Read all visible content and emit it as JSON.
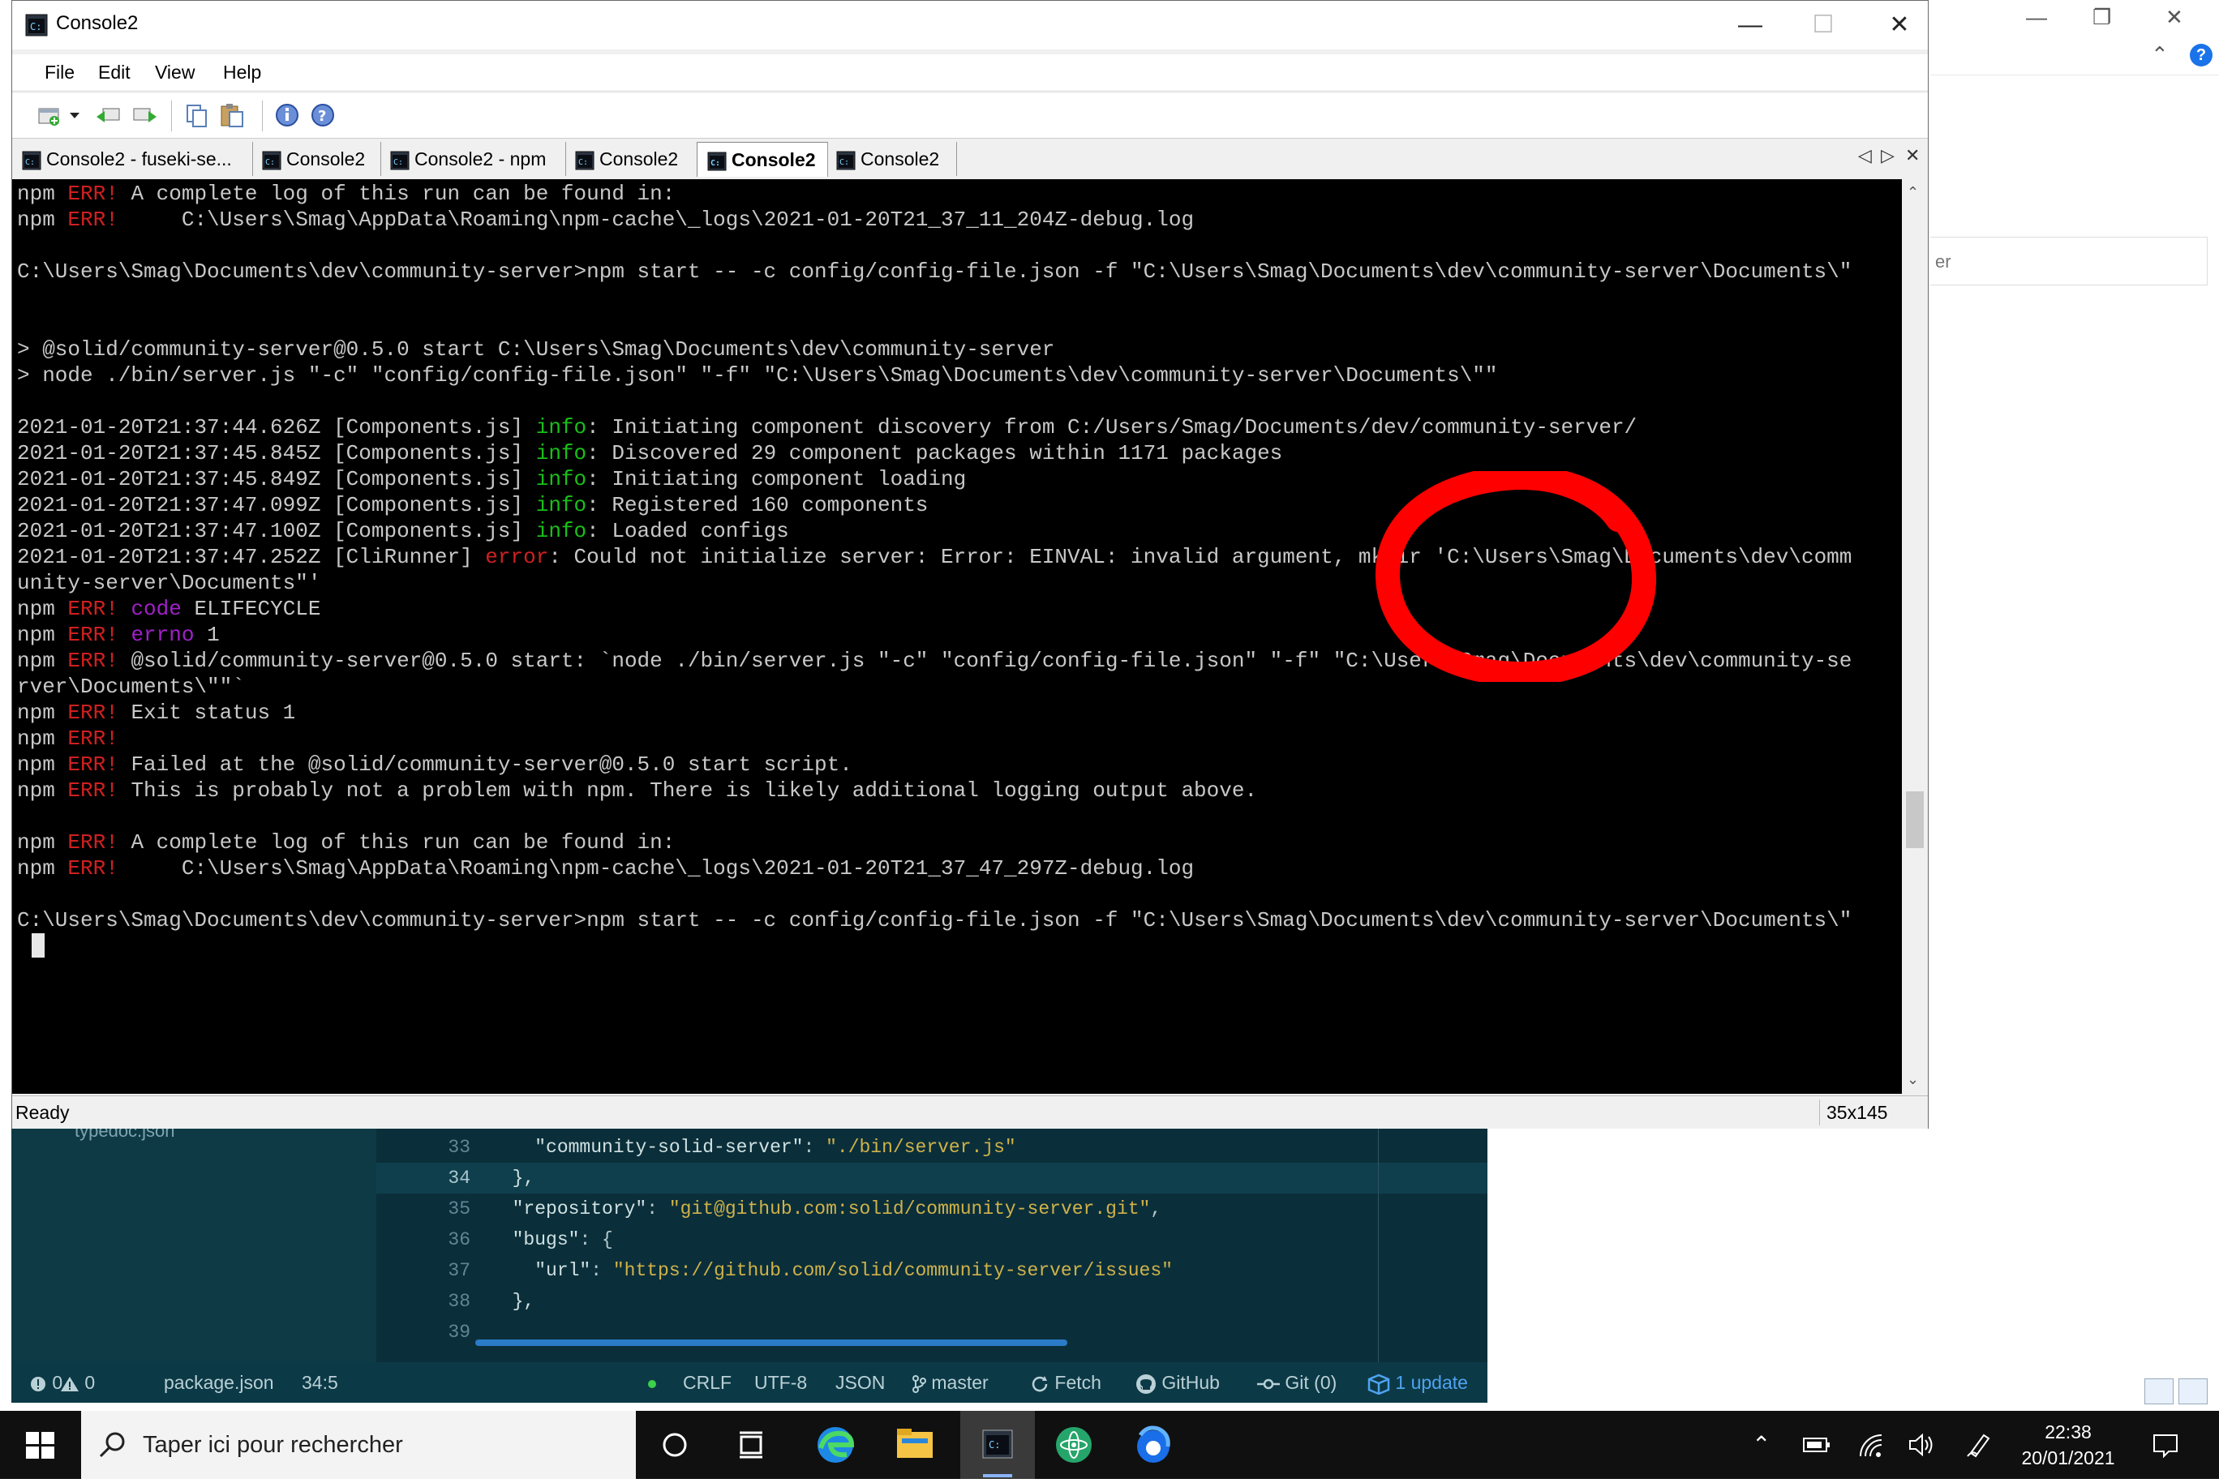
{
  "background_window": {
    "field_partial_text": "er"
  },
  "vscode": {
    "tree_item": "typedoc.json",
    "code_lines": [
      {
        "num": "33",
        "indent": "    ",
        "key": "\"community-solid-server\"",
        "sep": ": ",
        "value": "\"./bin/server.js\"",
        "tail": ""
      },
      {
        "num": "34",
        "indent": "  ",
        "key": "},",
        "sep": "",
        "value": "",
        "tail": ""
      },
      {
        "num": "35",
        "indent": "  ",
        "key": "\"repository\"",
        "sep": ": ",
        "value": "\"git@github.com:solid/community-server.git\"",
        "tail": ","
      },
      {
        "num": "36",
        "indent": "  ",
        "key": "\"bugs\"",
        "sep": ": {",
        "value": "",
        "tail": ""
      },
      {
        "num": "37",
        "indent": "    ",
        "key": "\"url\"",
        "sep": ": ",
        "value": "\"https://github.com/solid/community-server/issues\"",
        "tail": ""
      },
      {
        "num": "38",
        "indent": "  ",
        "key": "},",
        "sep": "",
        "value": "",
        "tail": ""
      },
      {
        "num": "39",
        "indent": "",
        "key": "",
        "sep": "",
        "value": "",
        "tail": ""
      }
    ],
    "status": {
      "errors": "0",
      "warnings": "0",
      "file": "package.json",
      "position": "34:5",
      "eol": "CRLF",
      "encoding": "UTF-8",
      "language": "JSON",
      "branch": "master",
      "fetch": "Fetch",
      "github": "GitHub",
      "git": "Git (0)",
      "update": "1 update"
    }
  },
  "console": {
    "title": "Console2",
    "menu": [
      "File",
      "Edit",
      "View",
      "Help"
    ],
    "tabs": [
      {
        "label": "Console2 - fuseki-se...",
        "active": false
      },
      {
        "label": "Console2",
        "active": false
      },
      {
        "label": "Console2 - npm",
        "active": false
      },
      {
        "label": "Console2",
        "active": false
      },
      {
        "label": "Console2",
        "active": true
      },
      {
        "label": "Console2",
        "active": false
      }
    ],
    "terminal_lines": [
      [
        {
          "t": "npm "
        },
        {
          "t": "ERR!",
          "c": "red"
        },
        {
          "t": " A complete log of this run can be found in:"
        }
      ],
      [
        {
          "t": "npm "
        },
        {
          "t": "ERR!",
          "c": "red"
        },
        {
          "t": "     C:\\Users\\Smag\\AppData\\Roaming\\npm-cache\\_logs\\2021-01-20T21_37_11_204Z-debug.log"
        }
      ],
      [],
      [
        {
          "t": "C:\\Users\\Smag\\Documents\\dev\\community-server>npm start -- -c config/config-file.json -f \"C:\\Users\\Smag\\Documents\\dev\\community-server\\Documents\\\""
        }
      ],
      [],
      [],
      [
        {
          "t": "> @solid/community-server@0.5.0 start C:\\Users\\Smag\\Documents\\dev\\community-server"
        }
      ],
      [
        {
          "t": "> node ./bin/server.js \"-c\" \"config/config-file.json\" \"-f\" \"C:\\Users\\Smag\\Documents\\dev\\community-server\\Documents\\\"\""
        }
      ],
      [],
      [
        {
          "t": "2021-01-20T21:37:44.626Z [Components.js] "
        },
        {
          "t": "info",
          "c": "grn"
        },
        {
          "t": ": Initiating component discovery from C:/Users/Smag/Documents/dev/community-server/"
        }
      ],
      [
        {
          "t": "2021-01-20T21:37:45.845Z [Components.js] "
        },
        {
          "t": "info",
          "c": "grn"
        },
        {
          "t": ": Discovered 29 component packages within 1171 packages"
        }
      ],
      [
        {
          "t": "2021-01-20T21:37:45.849Z [Components.js] "
        },
        {
          "t": "info",
          "c": "grn"
        },
        {
          "t": ": Initiating component loading"
        }
      ],
      [
        {
          "t": "2021-01-20T21:37:47.099Z [Components.js] "
        },
        {
          "t": "info",
          "c": "grn"
        },
        {
          "t": ": Registered 160 components"
        }
      ],
      [
        {
          "t": "2021-01-20T21:37:47.100Z [Components.js] "
        },
        {
          "t": "info",
          "c": "grn"
        },
        {
          "t": ": Loaded configs"
        }
      ],
      [
        {
          "t": "2021-01-20T21:37:47.252Z [CliRunner] "
        },
        {
          "t": "error",
          "c": "red"
        },
        {
          "t": ": Could not initialize server: Error: EINVAL: invalid argument, mkdir 'C:\\Users\\Smag\\Documents\\dev\\comm"
        }
      ],
      [
        {
          "t": "unity-server\\Documents\"'"
        }
      ],
      [
        {
          "t": "npm "
        },
        {
          "t": "ERR!",
          "c": "red"
        },
        {
          "t": " "
        },
        {
          "t": "code",
          "c": "pur"
        },
        {
          "t": " ELIFECYCLE"
        }
      ],
      [
        {
          "t": "npm "
        },
        {
          "t": "ERR!",
          "c": "red"
        },
        {
          "t": " "
        },
        {
          "t": "errno",
          "c": "pur"
        },
        {
          "t": " 1"
        }
      ],
      [
        {
          "t": "npm "
        },
        {
          "t": "ERR!",
          "c": "red"
        },
        {
          "t": " @solid/community-server@0.5.0 start: `node ./bin/server.js \"-c\" \"config/config-file.json\" \"-f\" \"C:\\Users\\Smag\\Documents\\dev\\community-se"
        }
      ],
      [
        {
          "t": "rver\\Documents\\\"\"`"
        }
      ],
      [
        {
          "t": "npm "
        },
        {
          "t": "ERR!",
          "c": "red"
        },
        {
          "t": " Exit status 1"
        }
      ],
      [
        {
          "t": "npm "
        },
        {
          "t": "ERR!",
          "c": "red"
        }
      ],
      [
        {
          "t": "npm "
        },
        {
          "t": "ERR!",
          "c": "red"
        },
        {
          "t": " Failed at the @solid/community-server@0.5.0 start script."
        }
      ],
      [
        {
          "t": "npm "
        },
        {
          "t": "ERR!",
          "c": "red"
        },
        {
          "t": " This is probably not a problem with npm. There is likely additional logging output above."
        }
      ],
      [],
      [
        {
          "t": "npm "
        },
        {
          "t": "ERR!",
          "c": "red"
        },
        {
          "t": " A complete log of this run can be found in:"
        }
      ],
      [
        {
          "t": "npm "
        },
        {
          "t": "ERR!",
          "c": "red"
        },
        {
          "t": "     C:\\Users\\Smag\\AppData\\Roaming\\npm-cache\\_logs\\2021-01-20T21_37_47_297Z-debug.log"
        }
      ],
      [],
      [
        {
          "t": "C:\\Users\\Smag\\Documents\\dev\\community-server>npm start -- -c config/config-file.json -f \"C:\\Users\\Smag\\Documents\\dev\\community-server\\Documents\\\""
        }
      ]
    ],
    "status_text": "Ready",
    "console_size": "35x145",
    "annotation_color": "#ff0000"
  },
  "taskbar": {
    "search_placeholder": "Taper ici pour rechercher",
    "time": "22:38",
    "date": "20/01/2021"
  }
}
